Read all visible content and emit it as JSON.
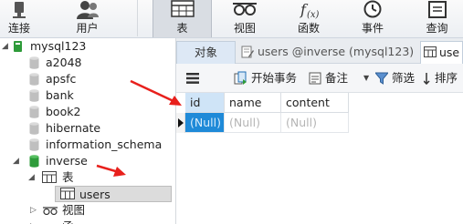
{
  "toolbar": {
    "items": [
      {
        "label": "连接",
        "icon": "connection-icon"
      },
      {
        "label": "用户",
        "icon": "user-icon"
      },
      {
        "label": "表",
        "icon": "table-icon",
        "active": true
      },
      {
        "label": "视图",
        "icon": "view-icon"
      },
      {
        "label": "函数",
        "icon": "function-icon"
      },
      {
        "label": "事件",
        "icon": "event-icon"
      },
      {
        "label": "查询",
        "icon": "query-icon"
      }
    ]
  },
  "sidebar": {
    "connection": "mysql123",
    "databases": [
      "a2048",
      "apsfc",
      "bank",
      "book2",
      "hibernate",
      "information_schema",
      "inverse"
    ],
    "expanded_db": "inverse",
    "tables_folder": "表",
    "selected_table": "users",
    "views_folder": "视图",
    "partial_next": "函"
  },
  "tabs": {
    "objects": "对象",
    "query": "users @inverse (mysql123) -",
    "table": "use"
  },
  "main_toolbar": {
    "begin_transaction": "开始事务",
    "memo": "备注",
    "filter": "筛选",
    "sort": "排序"
  },
  "grid": {
    "columns": [
      "id",
      "name",
      "content"
    ],
    "rows": [
      [
        "(Null)",
        "(Null)",
        "(Null)"
      ]
    ]
  },
  "colors": {
    "selected_cell": "#1f8ad8",
    "header_highlight": "#cfe4f7",
    "arrow": "#e8201c",
    "db_active_green": "#2e9b3a"
  }
}
